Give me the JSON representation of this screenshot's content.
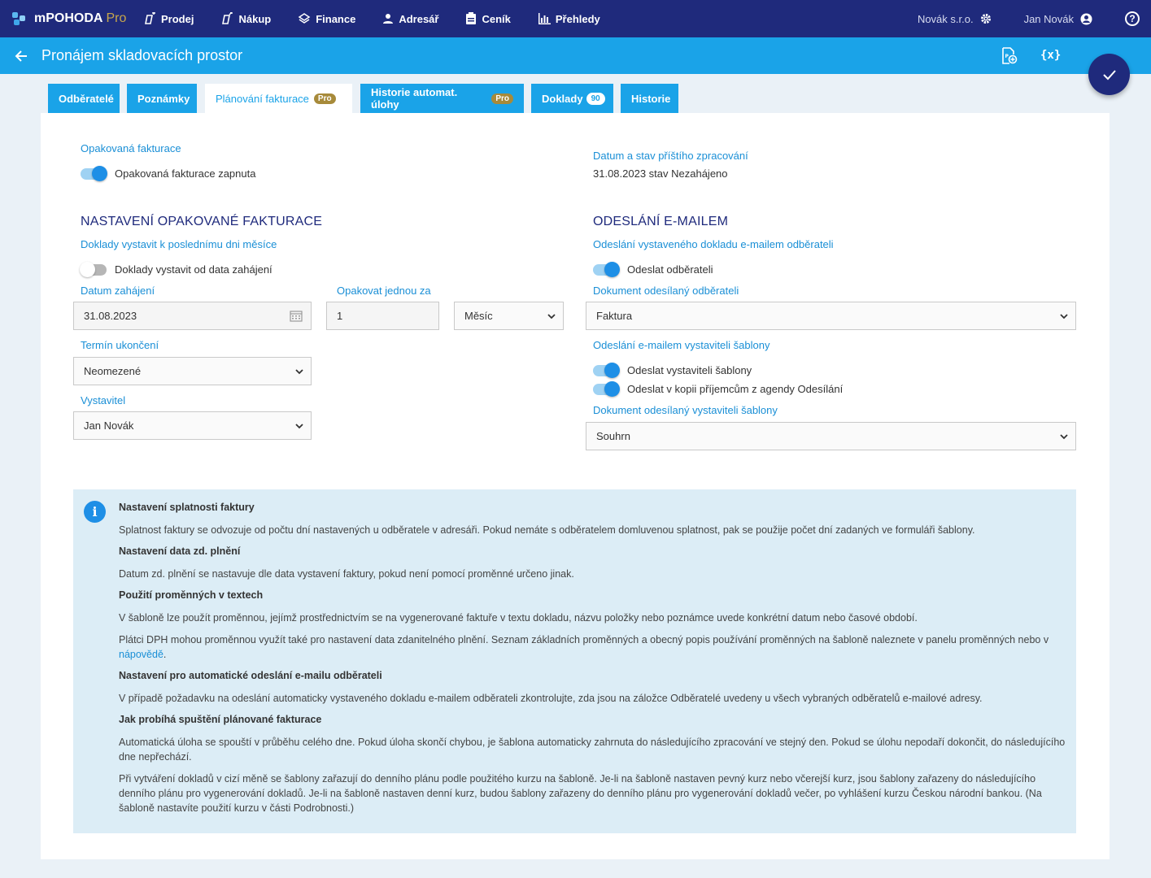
{
  "app": {
    "name": "mPOHODA",
    "edition": "Pro"
  },
  "nav": {
    "items": [
      {
        "label": "Prodej"
      },
      {
        "label": "Nákup"
      },
      {
        "label": "Finance"
      },
      {
        "label": "Adresář"
      },
      {
        "label": "Ceník"
      },
      {
        "label": "Přehledy"
      }
    ],
    "company": "Novák s.r.o.",
    "user": "Jan Novák",
    "help": "?"
  },
  "titlebar": {
    "title": "Pronájem skladovacích prostor",
    "variables_icon": "{x}"
  },
  "tabs": [
    {
      "label": "Odběratelé"
    },
    {
      "label": "Poznámky"
    },
    {
      "label": "Plánování fakturace",
      "badge": "Pro"
    },
    {
      "label": "Historie automat. úlohy",
      "badge": "Pro"
    },
    {
      "label": "Doklady",
      "count": "90"
    },
    {
      "label": "Historie"
    }
  ],
  "left": {
    "recurring_label": "Opakovaná fakturace",
    "recurring_toggle": "Opakovaná fakturace zapnuta",
    "section_title": "NASTAVENÍ OPAKOVANÉ FAKTURACE",
    "last_day_label": "Doklady vystavit k poslednímu dni měsíce",
    "last_day_toggle": "Doklady vystavit od data zahájení",
    "start_date_label": "Datum zahájení",
    "start_date_value": "31.08.2023",
    "repeat_label": "Opakovat jednou za",
    "repeat_value": "1",
    "repeat_unit": "Měsíc",
    "end_label": "Termín ukončení",
    "end_value": "Neomezené",
    "issuer_label": "Vystavitel",
    "issuer_value": "Jan Novák"
  },
  "right": {
    "next_label": "Datum a stav příštího zpracování",
    "next_value": "31.08.2023 stav Nezahájeno",
    "section_title": "ODESLÁNÍ E-MAILEM",
    "send_customer_label": "Odeslání vystaveného dokladu e-mailem odběrateli",
    "send_customer_toggle": "Odeslat odběrateli",
    "doc_customer_label": "Dokument odesílaný odběrateli",
    "doc_customer_value": "Faktura",
    "send_issuer_label": "Odeslání e-mailem vystaviteli šablony",
    "send_issuer_toggle": "Odeslat vystaviteli šablony",
    "send_copy_toggle": "Odeslat v kopii příjemcům z agendy Odesílání",
    "doc_issuer_label": "Dokument odesílaný vystaviteli šablony",
    "doc_issuer_value": "Souhrn"
  },
  "info": {
    "h1": "Nastavení splatnosti faktury",
    "p1": "Splatnost faktury se odvozuje od počtu dní nastavených u odběratele v adresáři. Pokud nemáte s odběratelem domluvenou splatnost, pak se použije počet dní zadaných ve formuláři šablony.",
    "h2": "Nastavení data zd. plnění",
    "p2": "Datum zd. plnění se nastavuje dle data vystavení faktury, pokud není pomocí proměnné určeno jinak.",
    "h3": "Použití proměnných v textech",
    "p3": "V šabloně lze použít proměnnou, jejímž prostřednictvím se na vygenerované faktuře v textu dokladu, názvu položky nebo poznámce uvede konkrétní datum nebo časové období.",
    "p4": "Plátci DPH mohou proměnnou využít také pro nastavení data zdanitelného plnění. Seznam základních proměnných a obecný popis používání proměnných na šabloně naleznete v panelu proměnných nebo v",
    "p4_link": "nápovědě",
    "p4_end": ".",
    "h4": "Nastavení pro automatické odeslání e-mailu odběrateli",
    "p5": "V případě požadavku na odeslání automaticky vystaveného dokladu e-mailem odběrateli zkontrolujte, zda jsou na záložce Odběratelé uvedeny u všech vybraných odběratelů e-mailové adresy.",
    "h5": "Jak probíhá spuštění plánované fakturace",
    "p6": "Automatická úloha se spouští v průběhu celého dne. Pokud úloha skončí chybou, je šablona automaticky zahrnuta do následujícího zpracování ve stejný den. Pokud se úlohu nepodaří dokončit, do následujícího dne nepřechází.",
    "p7": "Při vytváření dokladů v cizí měně se šablony zařazují do denního plánu podle použitého kurzu na šabloně. Je-li na šabloně nastaven pevný kurz nebo včerejší kurz, jsou šablony zařazeny do následujícího denního plánu pro vygenerování dokladů. Je-li na šabloně nastaven denní kurz, budou šablony zařazeny do denního plánu pro vygenerování dokladů večer, po vyhlášení kurzu Českou národní bankou. (Na šabloně nastavíte použití kurzu v části Podrobnosti.)"
  }
}
